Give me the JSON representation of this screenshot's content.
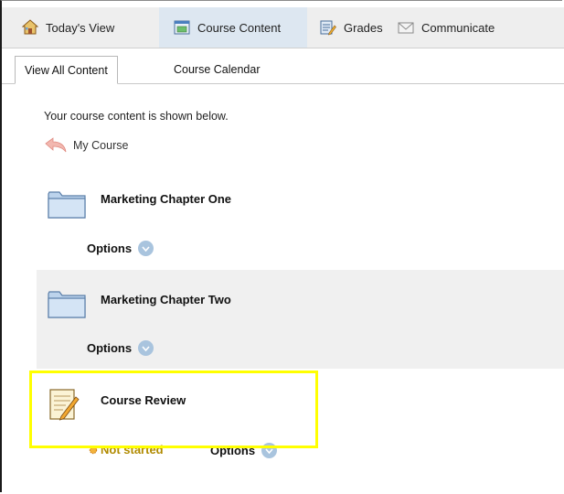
{
  "nav": {
    "items": [
      {
        "label": "Today's View",
        "icon": "home-icon"
      },
      {
        "label": "Course Content",
        "icon": "content-icon"
      },
      {
        "label": "Grades",
        "icon": "gradebook-icon"
      },
      {
        "label": "Communicate",
        "icon": "envelope-icon"
      }
    ]
  },
  "tabs": [
    {
      "label": "View All Content"
    },
    {
      "label": "Course Calendar"
    }
  ],
  "intro": "Your course content is shown below.",
  "breadcrumb": {
    "label": "My Course",
    "icon": "back-arrow-icon"
  },
  "items": [
    {
      "title": "Marketing Chapter One",
      "type": "folder",
      "options_label": "Options"
    },
    {
      "title": "Marketing Chapter Two",
      "type": "folder",
      "options_label": "Options"
    },
    {
      "title": "Course Review",
      "type": "assignment",
      "status": "Not started",
      "options_label": "Options"
    }
  ],
  "colors": {
    "highlight": "#ffff00",
    "status": "#b08a00",
    "nav_active": "#dde7f1",
    "chevron": "#a9c4de"
  }
}
